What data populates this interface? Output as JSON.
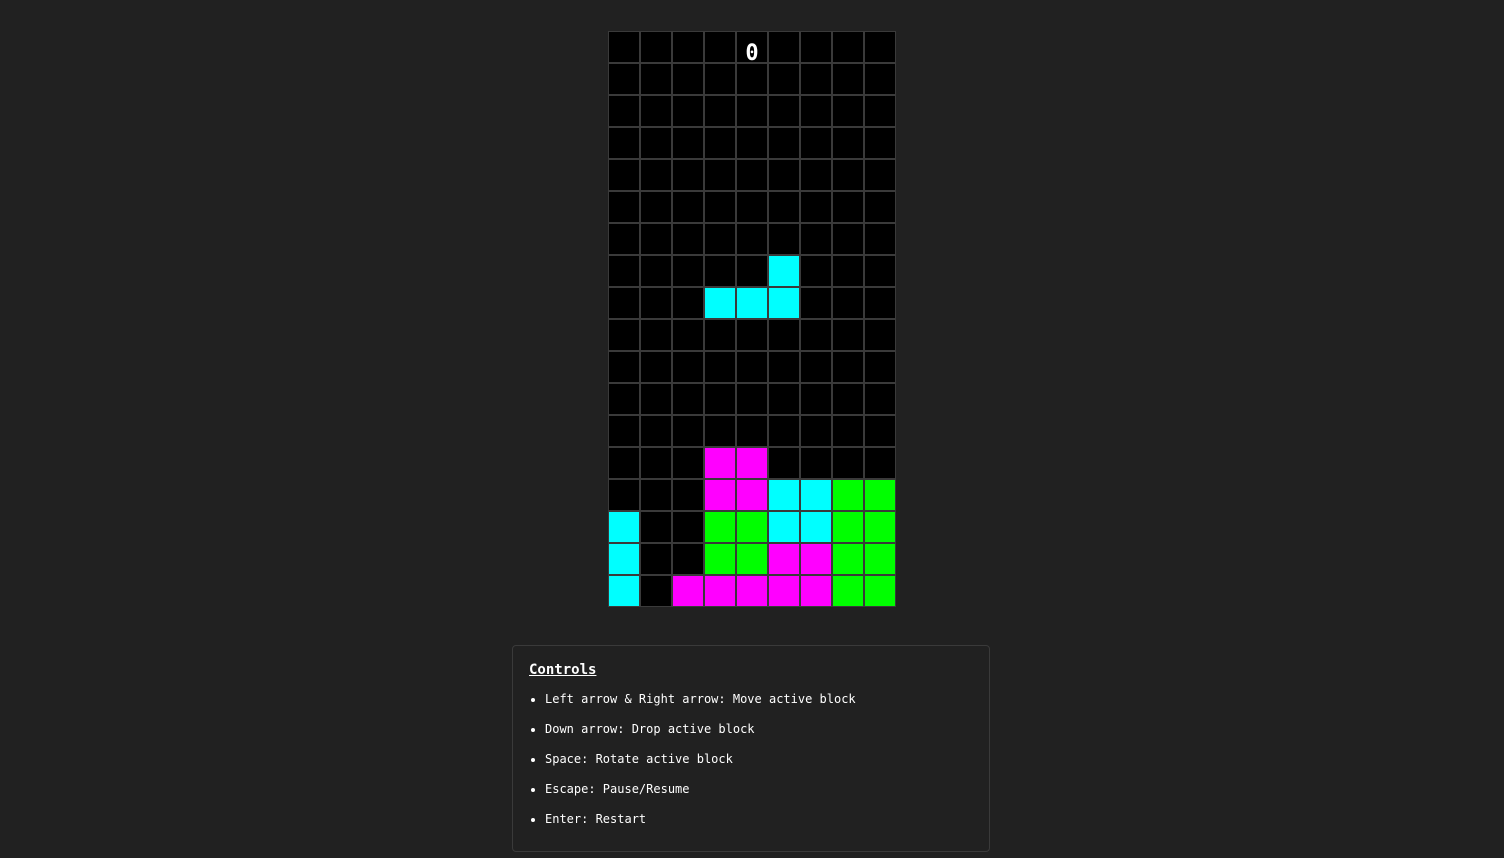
{
  "game": {
    "score": "0",
    "colors": {
      "empty": "#000000",
      "I": "#00ffff",
      "O": "#ff00ff",
      "S": "#00ff00",
      "grid_line": "#3a3a3a",
      "background": "#212121"
    },
    "board": [
      ".........",
      ".........",
      ".........",
      ".........",
      ".........",
      ".........",
      ".........",
      ".....I...",
      "...III...",
      ".........",
      ".........",
      ".........",
      ".........",
      "...OO....",
      "...OOIISS",
      "I..SSIISS",
      "I..SSOOSS",
      "I.OOOOOSS"
    ]
  },
  "controls": {
    "title": "Controls",
    "items": [
      "Left arrow & Right arrow: Move active block",
      "Down arrow: Drop active block",
      "Space: Rotate active block",
      "Escape: Pause/Resume",
      "Enter: Restart"
    ]
  }
}
